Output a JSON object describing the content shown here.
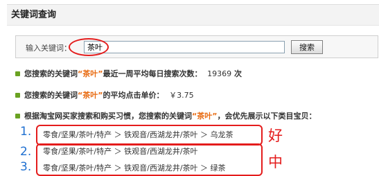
{
  "header": {
    "title": "关键词查询"
  },
  "search": {
    "label": "输入关键词：",
    "value": "茶叶",
    "button_label": "搜索"
  },
  "results": {
    "line1": {
      "prefix": "您搜索的关键词",
      "keyword": "“茶叶”",
      "middle": "最近一周平均每日搜索次数：",
      "count": "19369",
      "unit": "次"
    },
    "line2": {
      "prefix": "您搜索的关键词",
      "keyword": "“茶叶”",
      "middle": "的平均点击单价：",
      "price": "￥3.75"
    },
    "line3": {
      "prefix": "根据淘宝网买家搜索和购买习惯，您搜索的关键词",
      "keyword": "“茶叶”",
      "suffix": "，会优先展示以下类目宝贝："
    }
  },
  "categories": [
    {
      "rank": "1.",
      "path": "零食/坚果/茶叶/特产 ＞ 铁观音/西湖龙井/茶叶 ＞ 乌龙茶"
    },
    {
      "rank": "2.",
      "path": "零食/坚果/茶叶/特产 ＞ 铁观音/西湖龙井/茶叶"
    },
    {
      "rank": "3.",
      "path": "零食/坚果/茶叶/特产 ＞ 铁观音/西湖龙井/茶叶 ＞ 绿茶"
    }
  ],
  "annotations": {
    "good": "好",
    "medium": "中"
  },
  "colors": {
    "keyword": "#e86a10",
    "annotation": "#e41c1c",
    "rank": "#1e6fd0",
    "bullet": "#6aa222"
  }
}
